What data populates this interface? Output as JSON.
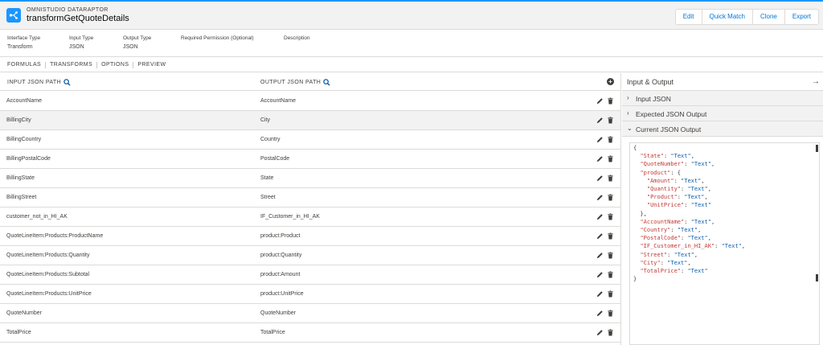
{
  "header": {
    "eyebrow": "OMNISTUDIO DATARAPTOR",
    "title": "transformGetQuoteDetails",
    "buttons": [
      "Edit",
      "Quick Match",
      "Clone",
      "Export"
    ],
    "accent": "#1b96ff"
  },
  "meta": {
    "fields": [
      {
        "label": "Interface Type",
        "value": "Transform"
      },
      {
        "label": "Input Type",
        "value": "JSON"
      },
      {
        "label": "Output Type",
        "value": "JSON"
      },
      {
        "label": "Required Permission (Optional)",
        "value": ""
      },
      {
        "label": "Description",
        "value": ""
      }
    ]
  },
  "tabs": [
    "FORMULAS",
    "TRANSFORMS",
    "OPTIONS",
    "PREVIEW"
  ],
  "mapping": {
    "input_header": "INPUT JSON PATH",
    "output_header": "OUTPUT JSON PATH",
    "rows": [
      {
        "input": "AccountName",
        "output": "AccountName"
      },
      {
        "input": "BillingCity",
        "output": "City"
      },
      {
        "input": "BillingCountry",
        "output": "Country"
      },
      {
        "input": "BillingPostalCode",
        "output": "PostalCode"
      },
      {
        "input": "BillingState",
        "output": "State"
      },
      {
        "input": "BillingStreet",
        "output": "Street"
      },
      {
        "input": "customer_not_in_HI_AK",
        "output": "IF_Customer_in_HI_AK"
      },
      {
        "input": "QuoteLineItem:Products:ProductName",
        "output": "product:Product"
      },
      {
        "input": "QuoteLineItem:Products:Quantity",
        "output": "product:Quantity"
      },
      {
        "input": "QuoteLineItem:Products:Subtotal",
        "output": "product:Amount"
      },
      {
        "input": "QuoteLineItem:Products:UnitPrice",
        "output": "product:UnitPrice"
      },
      {
        "input": "QuoteNumber",
        "output": "QuoteNumber"
      },
      {
        "input": "TotalPrice",
        "output": "TotalPrice"
      }
    ],
    "selected_row": "BillingCity"
  },
  "io_panel": {
    "title": "Input & Output",
    "sections": [
      {
        "label": "Input JSON",
        "expanded": false
      },
      {
        "label": "Expected JSON Output",
        "expanded": false
      },
      {
        "label": "Current JSON Output",
        "expanded": true
      }
    ],
    "json_lines": [
      "{",
      "  \"State\": \"Text\",",
      "  \"QuoteNumber\": \"Text\",",
      "  \"product\": {",
      "    \"Amount\": \"Text\",",
      "    \"Quantity\": \"Text\",",
      "    \"Product\": \"Text\",",
      "    \"UnitPrice\": \"Text\"",
      "  },",
      "  \"AccountName\": \"Text\",",
      "  \"Country\": \"Text\",",
      "  \"PostalCode\": \"Text\",",
      "  \"IF_Customer_in_HI_AK\": \"Text\",",
      "  \"Street\": \"Text\",",
      "  \"City\": \"Text\",",
      "  \"TotalPrice\": \"Text\"",
      "}"
    ]
  }
}
